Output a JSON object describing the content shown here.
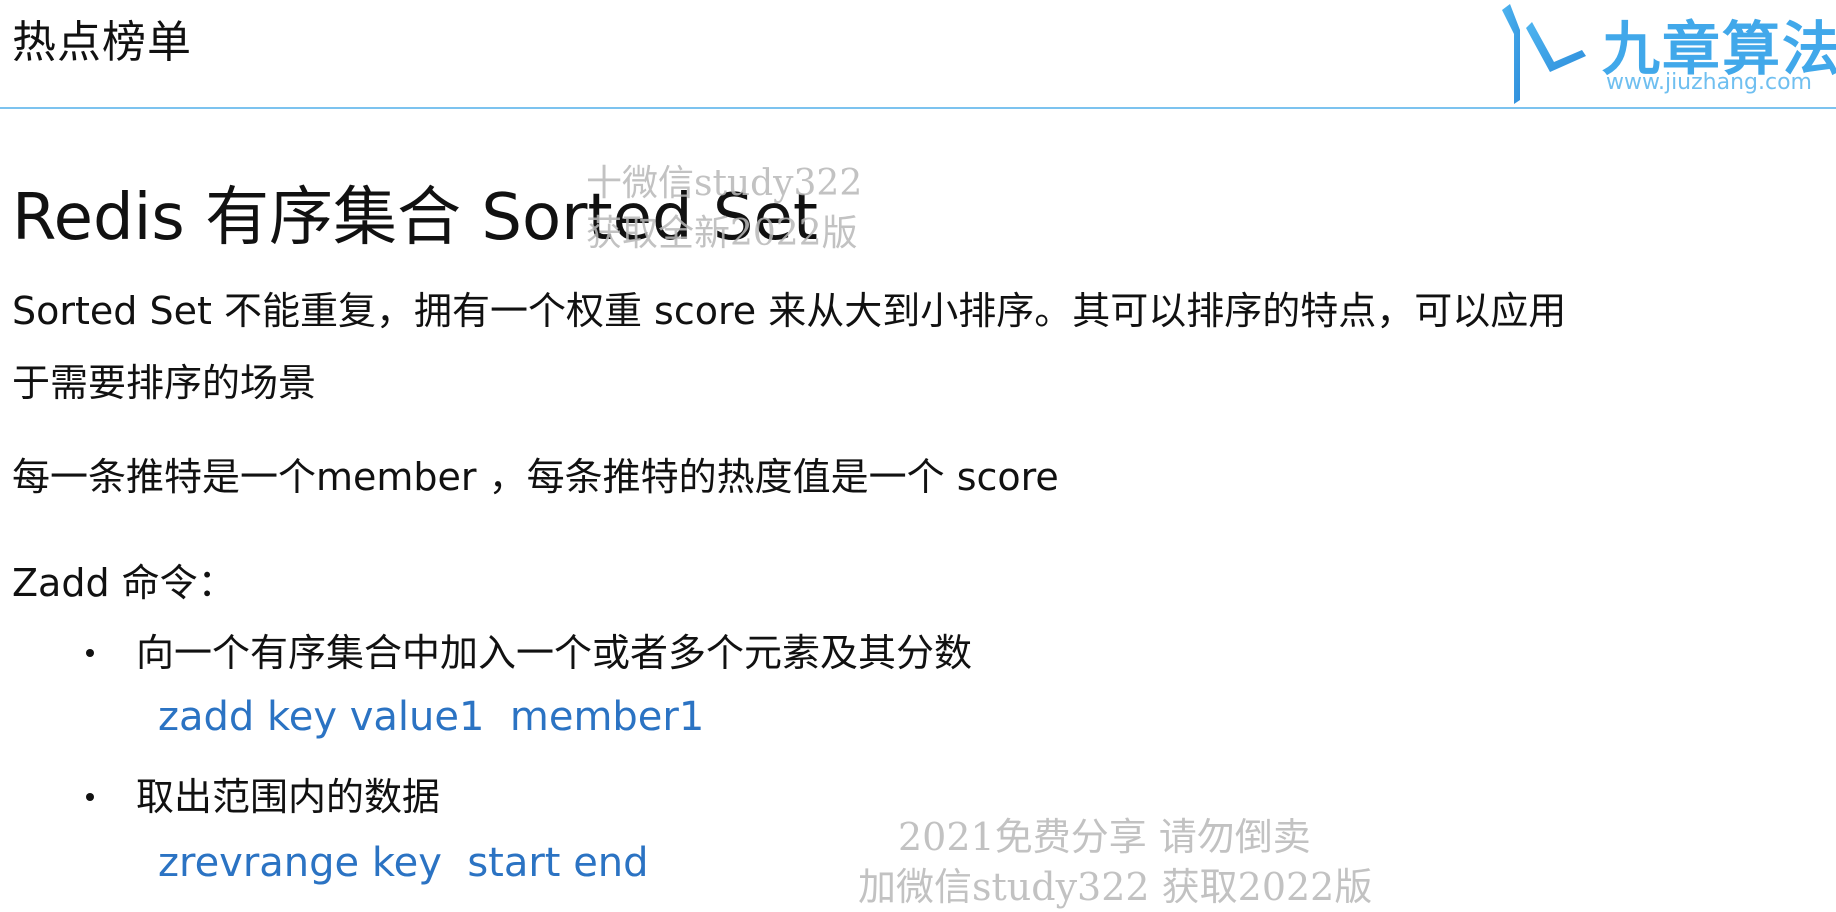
{
  "header": {
    "title": "热点榜单"
  },
  "logo": {
    "name": "九章算法",
    "url": "www.jiuzhang.com",
    "color": "#41a8ea"
  },
  "slide": {
    "section_title": "Redis 有序集合 Sorted Set",
    "paragraph1_line1": "Sorted Set 不能重复，拥有一个权重 score 来从大到小排序。其可以排序的特点，可以应用",
    "paragraph1_line2": "于需要排序的场景",
    "paragraph2": "每一条推特是一个member ，每条推特的热度值是一个 score",
    "paragraph3": "Zadd 命令：",
    "bullets": [
      {
        "text": "向一个有序集合中加入一个或者多个元素及其分数",
        "code": "zadd key value1  member1"
      },
      {
        "text": "取出范围内的数据",
        "code": "zrevrange key  start end"
      }
    ],
    "code_color": "#2b73c3"
  },
  "watermarks": {
    "top_line1": "十微信study322",
    "top_line2": "获取全新2022版",
    "bottom_line1": "2021免费分享  请勿倒卖",
    "bottom_line2": "加微信study322  获取2022版"
  }
}
